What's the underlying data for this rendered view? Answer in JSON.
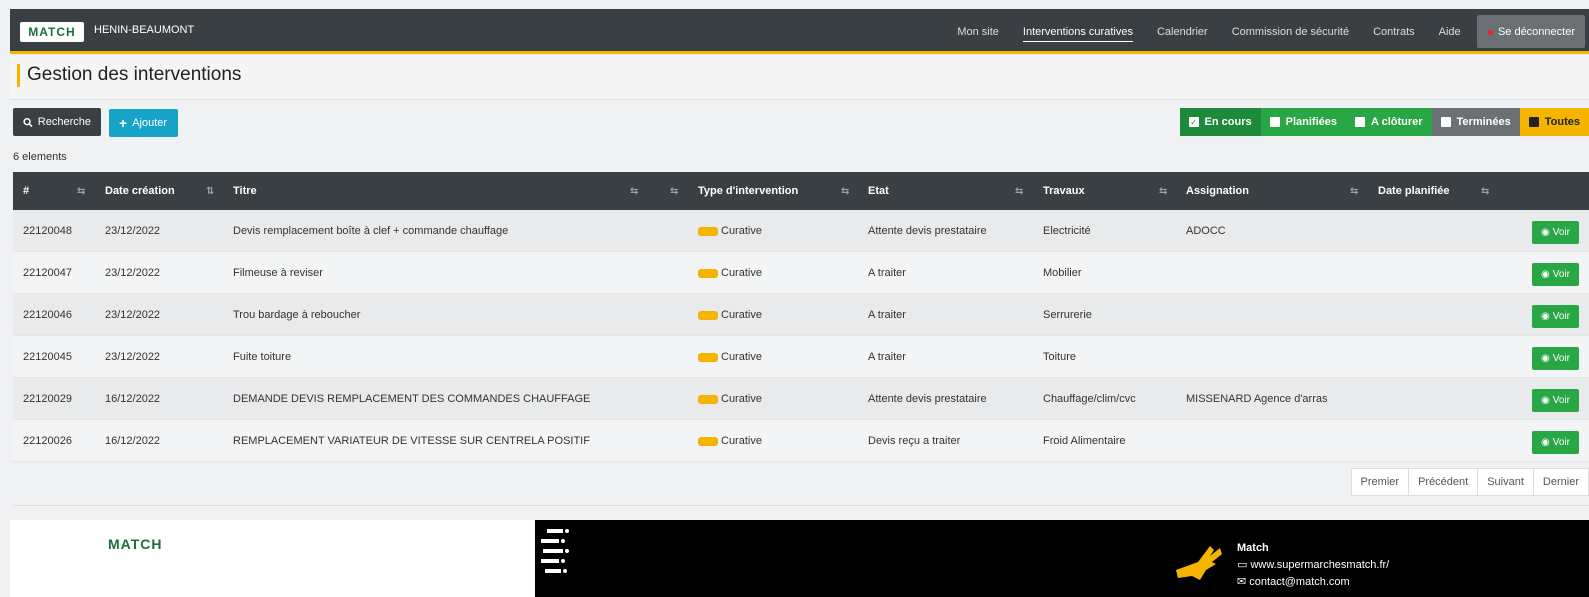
{
  "header": {
    "logo_text": "MATCH",
    "site_name": "HENIN-BEAUMONT",
    "nav": [
      {
        "label": "Mon site",
        "active": false
      },
      {
        "label": "Interventions curatives",
        "active": true
      },
      {
        "label": "Calendrier",
        "active": false
      },
      {
        "label": "Commission de sécurité",
        "active": false
      },
      {
        "label": "Contrats",
        "active": false
      },
      {
        "label": "Aide",
        "active": false
      }
    ],
    "logout_label": "Se déconnecter"
  },
  "page": {
    "title": "Gestion des interventions",
    "search_label": "Recherche",
    "add_label": "Ajouter",
    "count_text": "6 elements"
  },
  "filters": [
    {
      "label": "En cours",
      "checked": true
    },
    {
      "label": "Planifiées",
      "checked": false
    },
    {
      "label": "A clôturer",
      "checked": false
    },
    {
      "label": "Terminées",
      "checked": false
    },
    {
      "label": "Toutes",
      "checked": false
    }
  ],
  "table": {
    "headers": [
      "#",
      "Date création",
      "Titre",
      "Type d'intervention",
      "Etat",
      "Travaux",
      "Assignation",
      "Date planifiée"
    ],
    "view_label": "Voir",
    "rows": [
      {
        "id": "22120048",
        "date": "23/12/2022",
        "title": "Devis remplacement boîte à clef + commande chauffage",
        "type": "Curative",
        "state": "Attente devis prestataire",
        "works": "Electricité",
        "assign": "ADOCC",
        "planned": ""
      },
      {
        "id": "22120047",
        "date": "23/12/2022",
        "title": "Filmeuse à reviser",
        "type": "Curative",
        "state": "A traiter",
        "works": "Mobilier",
        "assign": "",
        "planned": ""
      },
      {
        "id": "22120046",
        "date": "23/12/2022",
        "title": "Trou bardage à reboucher",
        "type": "Curative",
        "state": "A traiter",
        "works": "Serrurerie",
        "assign": "",
        "planned": ""
      },
      {
        "id": "22120045",
        "date": "23/12/2022",
        "title": "Fuite toiture",
        "type": "Curative",
        "state": "A traiter",
        "works": "Toiture",
        "assign": "",
        "planned": ""
      },
      {
        "id": "22120029",
        "date": "16/12/2022",
        "title": "DEMANDE DEVIS REMPLACEMENT DES COMMANDES CHAUFFAGE",
        "type": "Curative",
        "state": "Attente devis prestataire",
        "works": "Chauffage/clim/cvc",
        "assign": "MISSENARD Agence d'arras",
        "planned": ""
      },
      {
        "id": "22120026",
        "date": "16/12/2022",
        "title": "REMPLACEMENT VARIATEUR DE VITESSE SUR CENTRELA POSITIF",
        "type": "Curative",
        "state": "Devis reçu a traiter",
        "works": "Froid Alimentaire",
        "assign": "",
        "planned": ""
      }
    ]
  },
  "pagination": [
    "Premier",
    "Précédent",
    "Suivant",
    "Dernier"
  ],
  "footer": {
    "logo_text": "MATCH",
    "company": "Match",
    "website": "www.supermarchesmatch.fr/",
    "email": "contact@match.com"
  },
  "colors": {
    "accent": "#f5b400",
    "nav_bg": "#3a3f44",
    "green": "#29a744",
    "teal": "#17a2c7"
  }
}
